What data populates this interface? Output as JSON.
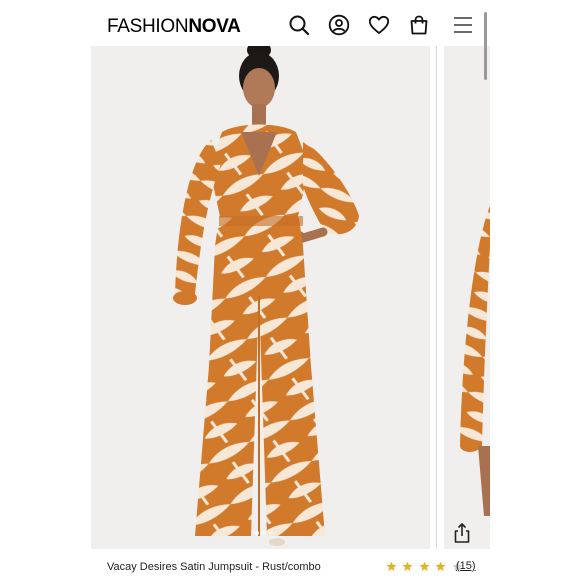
{
  "brand": {
    "part1": "FASHION",
    "part2": "NOVA"
  },
  "header_icons": [
    "search-icon",
    "account-icon",
    "heart-icon",
    "bag-icon",
    "menu-icon"
  ],
  "product": {
    "name": "Vacay Desires Satin Jumpsuit - Rust/combo",
    "rating": 4,
    "rating_max": 5,
    "reviews": "(15)"
  },
  "gallery": {
    "image_count": 3,
    "active_index": 0
  },
  "colors": {
    "rust": "#d27a2c",
    "cream": "#f6e7d6",
    "star": "#e2b626"
  }
}
